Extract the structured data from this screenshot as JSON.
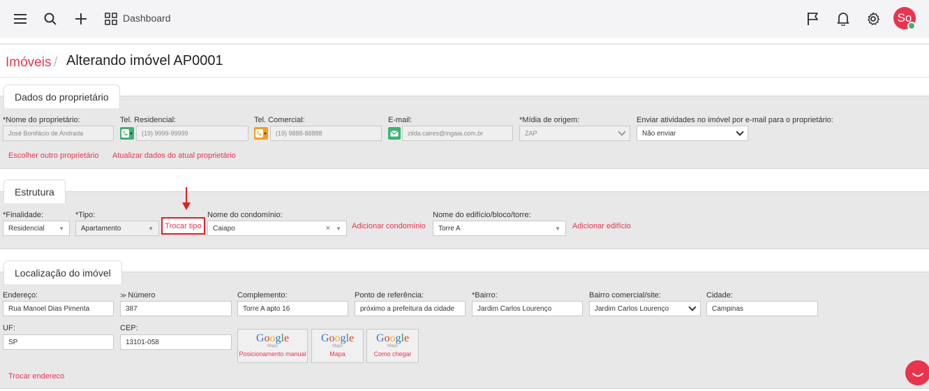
{
  "topbar": {
    "dashboard_label": "Dashboard",
    "avatar_initials": "So",
    "icons": [
      "menu-icon",
      "search-icon",
      "plus-icon",
      "grid-icon",
      "flag-icon",
      "bell-icon",
      "gear-icon"
    ]
  },
  "breadcrumb": {
    "parent": "Imóveis",
    "separator": "/",
    "title": "Alterando imóvel AP0001"
  },
  "owner_section": {
    "tab": "Dados do proprietário",
    "name_label": "*Nome do proprietário:",
    "name_value": "José Bonifácio de Andrada",
    "tel_res_label": "Tel. Residencial:",
    "tel_res_value": "(19) 9999-99999",
    "tel_com_label": "Tel. Comercial:",
    "tel_com_value": "(19) 9888-88888",
    "email_label": "E-mail:",
    "email_value": "zilda.caires@ingaia.com.br",
    "media_label": "*Mídia de origem:",
    "media_value": "ZAP",
    "send_label": "Enviar atividades no imóvel por e-mail para o proprietário:",
    "send_value": "Não enviar",
    "link_choose": "Escolher outro proprietário",
    "link_update": "Atualizar dados do atual proprietário"
  },
  "structure_section": {
    "tab": "Estrutura",
    "finalidade_label": "*Finalidade:",
    "finalidade_value": "Residencial",
    "tipo_label": "*Tipo:",
    "tipo_value": "Apartamento",
    "trocar_tipo": "Trocar tipo",
    "condominio_label": "Nome do condomínio:",
    "condominio_value": "Caiapo",
    "add_condominio": "Adicionar condomínio",
    "edificio_label": "Nome do edifício/bloco/torre:",
    "edificio_value": "Torre A",
    "add_edificio": "Adicionar edifício"
  },
  "location_section": {
    "tab": "Localização do imóvel",
    "endereco_label": "Endereço:",
    "endereco_value": "Rua Manoel Dias Pimenta",
    "numero_label": "Número",
    "numero_value": "387",
    "complemento_label": "Complemento:",
    "complemento_value": "Torre A apto 16",
    "referencia_label": "Ponto de referência:",
    "referencia_value": "próximo a prefeitura da cidade",
    "bairro_label": "*Bairro:",
    "bairro_value": "Jardim Carlos Lourenço",
    "bairro_comercial_label": "Bairro comercial/site:",
    "bairro_comercial_value": "Jardim Carlos Lourenço",
    "cidade_label": "Cidade:",
    "cidade_value": "Campinas",
    "uf_label": "UF:",
    "uf_value": "SP",
    "cep_label": "CEP:",
    "cep_value": "13101-058",
    "google_logo": "Google",
    "google_maps_small": "Maps",
    "btn_manual": "Posicionamento manual",
    "btn_mapa": "Mapa",
    "btn_chegar": "Como chegar",
    "link_trocar_endereco": "Trocar endereco"
  },
  "colors": {
    "accent": "#e8344e",
    "section_bg": "#e8e8e8",
    "phone_res": "#3cb371",
    "phone_com": "#f0a020",
    "email_icon": "#3cb371"
  }
}
